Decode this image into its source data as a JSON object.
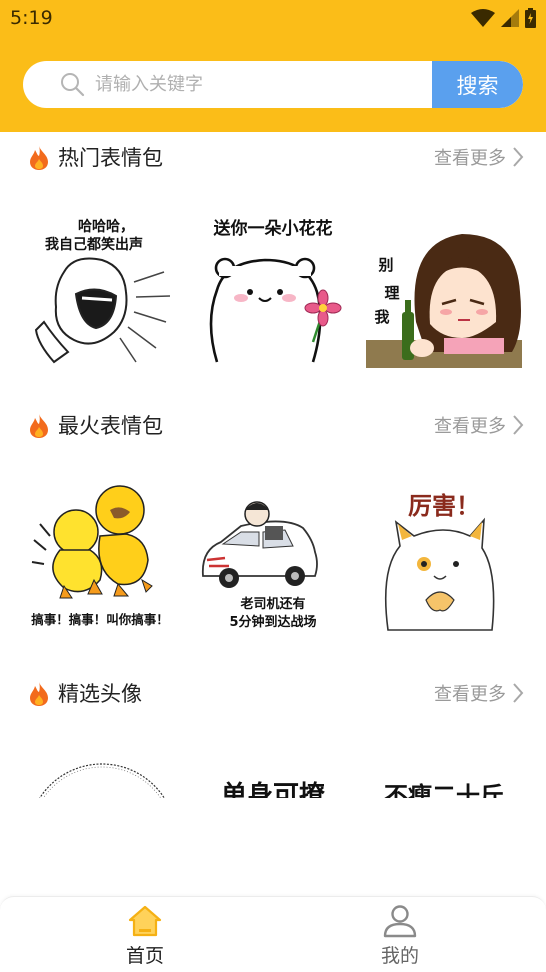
{
  "status_bar": {
    "time": "5:19"
  },
  "search": {
    "placeholder": "请输入关键字",
    "value": "",
    "button_label": "搜索"
  },
  "sections": [
    {
      "title": "热门表情包",
      "more_label": "查看更多",
      "stickers": [
        {
          "caption_lines": [
            "哈哈哈，",
            "我自己都笑出声"
          ]
        },
        {
          "caption_lines": [
            "送你一朵小花花"
          ]
        },
        {
          "caption_lines": [
            "别",
            "理",
            "我"
          ]
        }
      ]
    },
    {
      "title": "最火表情包",
      "more_label": "查看更多",
      "stickers": [
        {
          "caption_lines": [
            "搞事！搞事！叫你搞事！"
          ]
        },
        {
          "caption_lines": [
            "老司机还有",
            "5分钟到达战场"
          ]
        },
        {
          "caption_lines": [
            "厉害！"
          ]
        }
      ]
    },
    {
      "title": "精选头像",
      "more_label": "查看更多",
      "stickers": [
        {
          "caption_lines": []
        },
        {
          "caption_lines": [
            "单身可撩"
          ]
        },
        {
          "caption_lines": [
            "不瘦二十斤"
          ]
        }
      ]
    }
  ],
  "bottom_nav": [
    {
      "label": "首页",
      "active": true
    },
    {
      "label": "我的",
      "active": false
    }
  ],
  "colors": {
    "header": "#fbbd18",
    "search_button": "#5aa0ee",
    "nav_active": "#f5b114",
    "nav_inactive": "#8a8a8a"
  },
  "icons": [
    "search-icon",
    "fire-icon",
    "chevron-right-icon",
    "home-icon",
    "person-icon",
    "wifi-icon",
    "signal-icon",
    "battery-icon"
  ]
}
